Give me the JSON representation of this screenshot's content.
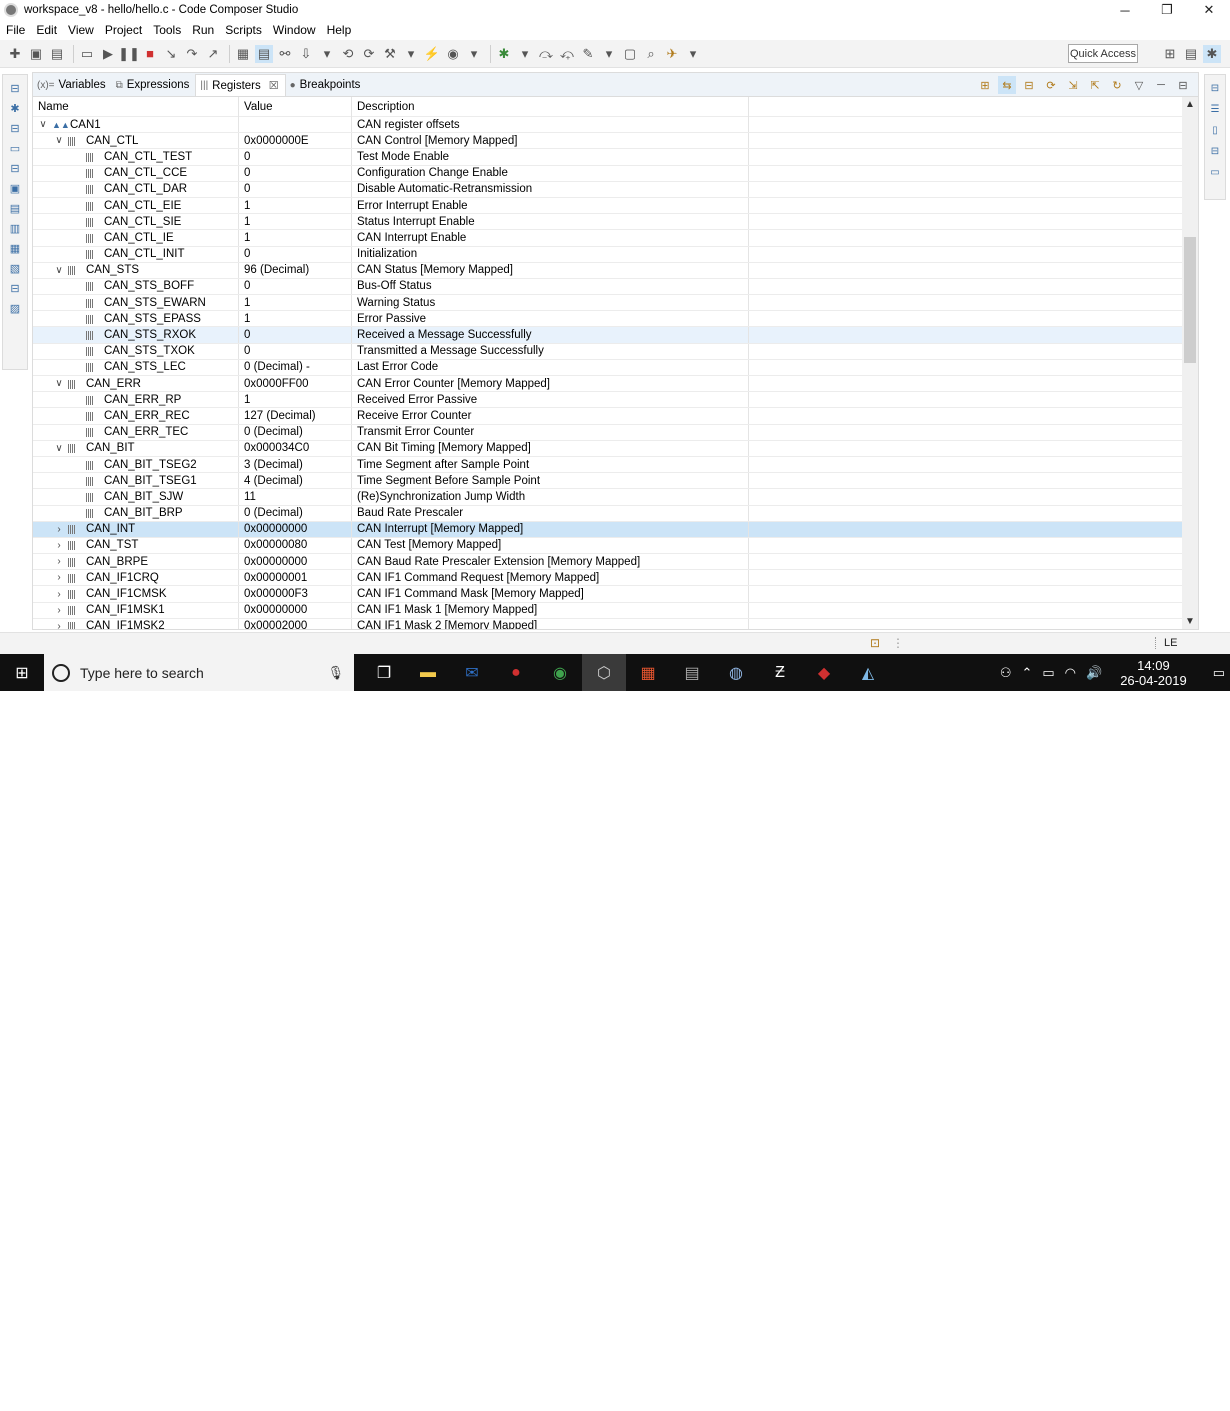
{
  "window": {
    "title": "workspace_v8 - hello/hello.c - Code Composer Studio",
    "minimize": "─",
    "restore": "❐",
    "close": "✕"
  },
  "menu": [
    "File",
    "Edit",
    "View",
    "Project",
    "Tools",
    "Run",
    "Scripts",
    "Window",
    "Help"
  ],
  "toolbar": {
    "quick_access": "Quick Access"
  },
  "tabs": [
    {
      "label": "Variables",
      "icon": "(x)="
    },
    {
      "label": "Expressions",
      "icon": "⧉"
    },
    {
      "label": "Registers",
      "icon": "|||",
      "active": true,
      "close": "☒"
    },
    {
      "label": "Breakpoints",
      "icon": "●"
    }
  ],
  "columns": {
    "name": "Name",
    "value": "Value",
    "description": "Description"
  },
  "rows": [
    {
      "name": "CAN1",
      "value": "",
      "desc": "CAN register offsets",
      "level": 0,
      "twisty": "∨",
      "kind": "group"
    },
    {
      "name": "CAN_CTL",
      "value": "0x0000000E",
      "desc": "CAN Control [Memory Mapped]",
      "level": 1,
      "twisty": "∨",
      "kind": "reg"
    },
    {
      "name": "CAN_CTL_TEST",
      "value": "0",
      "desc": "Test Mode Enable",
      "level": 2,
      "twisty": "",
      "kind": "field"
    },
    {
      "name": "CAN_CTL_CCE",
      "value": "0",
      "desc": "Configuration Change Enable",
      "level": 2,
      "twisty": "",
      "kind": "field"
    },
    {
      "name": "CAN_CTL_DAR",
      "value": "0",
      "desc": "Disable Automatic-Retransmission",
      "level": 2,
      "twisty": "",
      "kind": "field"
    },
    {
      "name": "CAN_CTL_EIE",
      "value": "1",
      "desc": "Error Interrupt Enable",
      "level": 2,
      "twisty": "",
      "kind": "field"
    },
    {
      "name": "CAN_CTL_SIE",
      "value": "1",
      "desc": "Status Interrupt Enable",
      "level": 2,
      "twisty": "",
      "kind": "field"
    },
    {
      "name": "CAN_CTL_IE",
      "value": "1",
      "desc": "CAN Interrupt Enable",
      "level": 2,
      "twisty": "",
      "kind": "field"
    },
    {
      "name": "CAN_CTL_INIT",
      "value": "0",
      "desc": "Initialization",
      "level": 2,
      "twisty": "",
      "kind": "field"
    },
    {
      "name": "CAN_STS",
      "value": "96 (Decimal)",
      "desc": "CAN Status [Memory Mapped]",
      "level": 1,
      "twisty": "∨",
      "kind": "reg"
    },
    {
      "name": "CAN_STS_BOFF",
      "value": "0",
      "desc": "Bus-Off Status",
      "level": 2,
      "twisty": "",
      "kind": "field"
    },
    {
      "name": "CAN_STS_EWARN",
      "value": "1",
      "desc": "Warning Status",
      "level": 2,
      "twisty": "",
      "kind": "field"
    },
    {
      "name": "CAN_STS_EPASS",
      "value": "1",
      "desc": "Error Passive",
      "level": 2,
      "twisty": "",
      "kind": "field"
    },
    {
      "name": "CAN_STS_RXOK",
      "value": "0",
      "desc": "Received a Message Successfully",
      "level": 2,
      "twisty": "",
      "kind": "field",
      "highlight": "light"
    },
    {
      "name": "CAN_STS_TXOK",
      "value": "0",
      "desc": "Transmitted a Message Successfully",
      "level": 2,
      "twisty": "",
      "kind": "field"
    },
    {
      "name": "CAN_STS_LEC",
      "value": "0 (Decimal) -",
      "desc": "Last Error Code",
      "level": 2,
      "twisty": "",
      "kind": "field"
    },
    {
      "name": "CAN_ERR",
      "value": "0x0000FF00",
      "desc": "CAN Error Counter [Memory Mapped]",
      "level": 1,
      "twisty": "∨",
      "kind": "reg"
    },
    {
      "name": "CAN_ERR_RP",
      "value": "1",
      "desc": "Received Error Passive",
      "level": 2,
      "twisty": "",
      "kind": "field"
    },
    {
      "name": "CAN_ERR_REC",
      "value": "127 (Decimal)",
      "desc": "Receive Error Counter",
      "level": 2,
      "twisty": "",
      "kind": "field"
    },
    {
      "name": "CAN_ERR_TEC",
      "value": "0 (Decimal)",
      "desc": "Transmit Error Counter",
      "level": 2,
      "twisty": "",
      "kind": "field"
    },
    {
      "name": "CAN_BIT",
      "value": "0x000034C0",
      "desc": "CAN Bit Timing [Memory Mapped]",
      "level": 1,
      "twisty": "∨",
      "kind": "reg"
    },
    {
      "name": "CAN_BIT_TSEG2",
      "value": "3 (Decimal)",
      "desc": "Time Segment after Sample Point",
      "level": 2,
      "twisty": "",
      "kind": "field"
    },
    {
      "name": "CAN_BIT_TSEG1",
      "value": "4 (Decimal)",
      "desc": "Time Segment Before Sample Point",
      "level": 2,
      "twisty": "",
      "kind": "field"
    },
    {
      "name": "CAN_BIT_SJW",
      "value": "11",
      "desc": "(Re)Synchronization Jump Width",
      "level": 2,
      "twisty": "",
      "kind": "field"
    },
    {
      "name": "CAN_BIT_BRP",
      "value": "0 (Decimal)",
      "desc": "Baud Rate Prescaler",
      "level": 2,
      "twisty": "",
      "kind": "field"
    },
    {
      "name": "CAN_INT",
      "value": "0x00000000",
      "desc": "CAN Interrupt [Memory Mapped]",
      "level": 1,
      "twisty": "›",
      "kind": "reg",
      "highlight": "selected"
    },
    {
      "name": "CAN_TST",
      "value": "0x00000080",
      "desc": "CAN Test [Memory Mapped]",
      "level": 1,
      "twisty": "›",
      "kind": "reg"
    },
    {
      "name": "CAN_BRPE",
      "value": "0x00000000",
      "desc": "CAN Baud Rate Prescaler Extension [Memory Mapped]",
      "level": 1,
      "twisty": "›",
      "kind": "reg"
    },
    {
      "name": "CAN_IF1CRQ",
      "value": "0x00000001",
      "desc": "CAN IF1 Command Request [Memory Mapped]",
      "level": 1,
      "twisty": "›",
      "kind": "reg"
    },
    {
      "name": "CAN_IF1CMSK",
      "value": "0x000000F3",
      "desc": "CAN IF1 Command Mask [Memory Mapped]",
      "level": 1,
      "twisty": "›",
      "kind": "reg"
    },
    {
      "name": "CAN_IF1MSK1",
      "value": "0x00000000",
      "desc": "CAN IF1 Mask 1 [Memory Mapped]",
      "level": 1,
      "twisty": "›",
      "kind": "reg"
    },
    {
      "name": "CAN_IF1MSK2",
      "value": "0x00002000",
      "desc": "CAN IF1 Mask 2 [Memory Mapped]",
      "level": 1,
      "twisty": "›",
      "kind": "reg"
    }
  ],
  "statusbar": {
    "mode": "LE"
  },
  "taskbar": {
    "search_placeholder": "Type here to search",
    "time": "14:09",
    "date": "26-04-2019"
  },
  "colors": {
    "selected_row": "#cce4f7",
    "hover_row": "#e8f2fc",
    "tab_bar": "#eef3f8",
    "taskbar": "#101010"
  }
}
